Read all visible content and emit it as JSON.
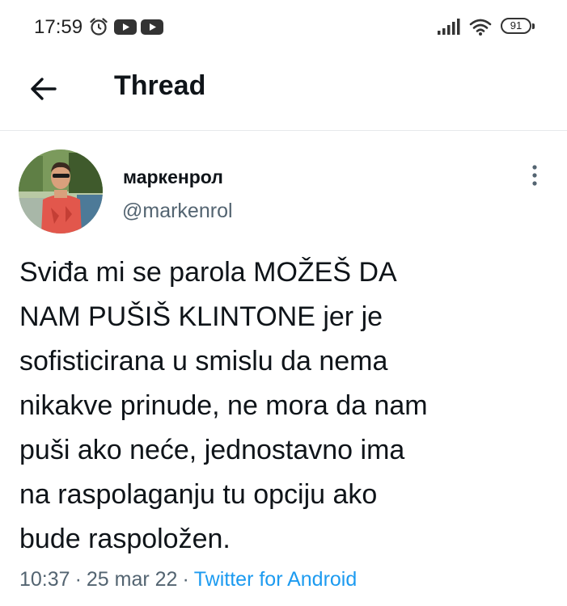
{
  "status_bar": {
    "time": "17:59",
    "battery": "91",
    "icons": [
      "alarm-icon",
      "youtube-icon",
      "youtube-icon",
      "signal-icon",
      "wifi-icon",
      "battery-icon"
    ]
  },
  "header": {
    "back_icon": "arrow-left-icon",
    "title": "Thread"
  },
  "tweet": {
    "author_name": "маркенрол",
    "author_handle": "@markenrol",
    "text_lines": [
      "Sviđa mi se parola MOŽEŠ DA",
      "NAM PUŠIŠ KLINTONE jer je",
      "sofisticirana u smislu da nema",
      "nikakve prinude, ne mora da nam",
      "puši ako neće, jednostavno ima",
      "na raspolaganju tu opciju ako",
      "bude raspoložen."
    ],
    "time": "10:37",
    "separator": "·",
    "date": "25 mar 22",
    "source": "Twitter for Android"
  },
  "colors": {
    "text": "#0f1419",
    "secondary": "#536471",
    "link": "#1d9bf0",
    "divider": "#e6e9eb"
  }
}
